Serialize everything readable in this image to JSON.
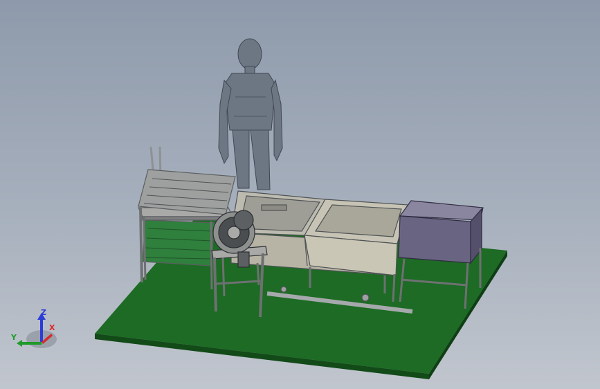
{
  "viewport": {
    "background_top": "#8e9aab",
    "background_bottom": "#c1c6ce"
  },
  "scene": {
    "description_icon": "cad-assembly-model",
    "colors": {
      "ground_plate": "#1d6b24",
      "human_figure": "#6d7784",
      "frames": "#a9aaa8",
      "tanks": "#b7b4a6",
      "cabinet": "#6a6483"
    }
  },
  "triad": {
    "x_label": "X",
    "y_label": "Y",
    "z_label": "Z",
    "x_color": "#d62b2b",
    "y_color": "#1f9a2b",
    "z_color": "#2b3dd6"
  }
}
